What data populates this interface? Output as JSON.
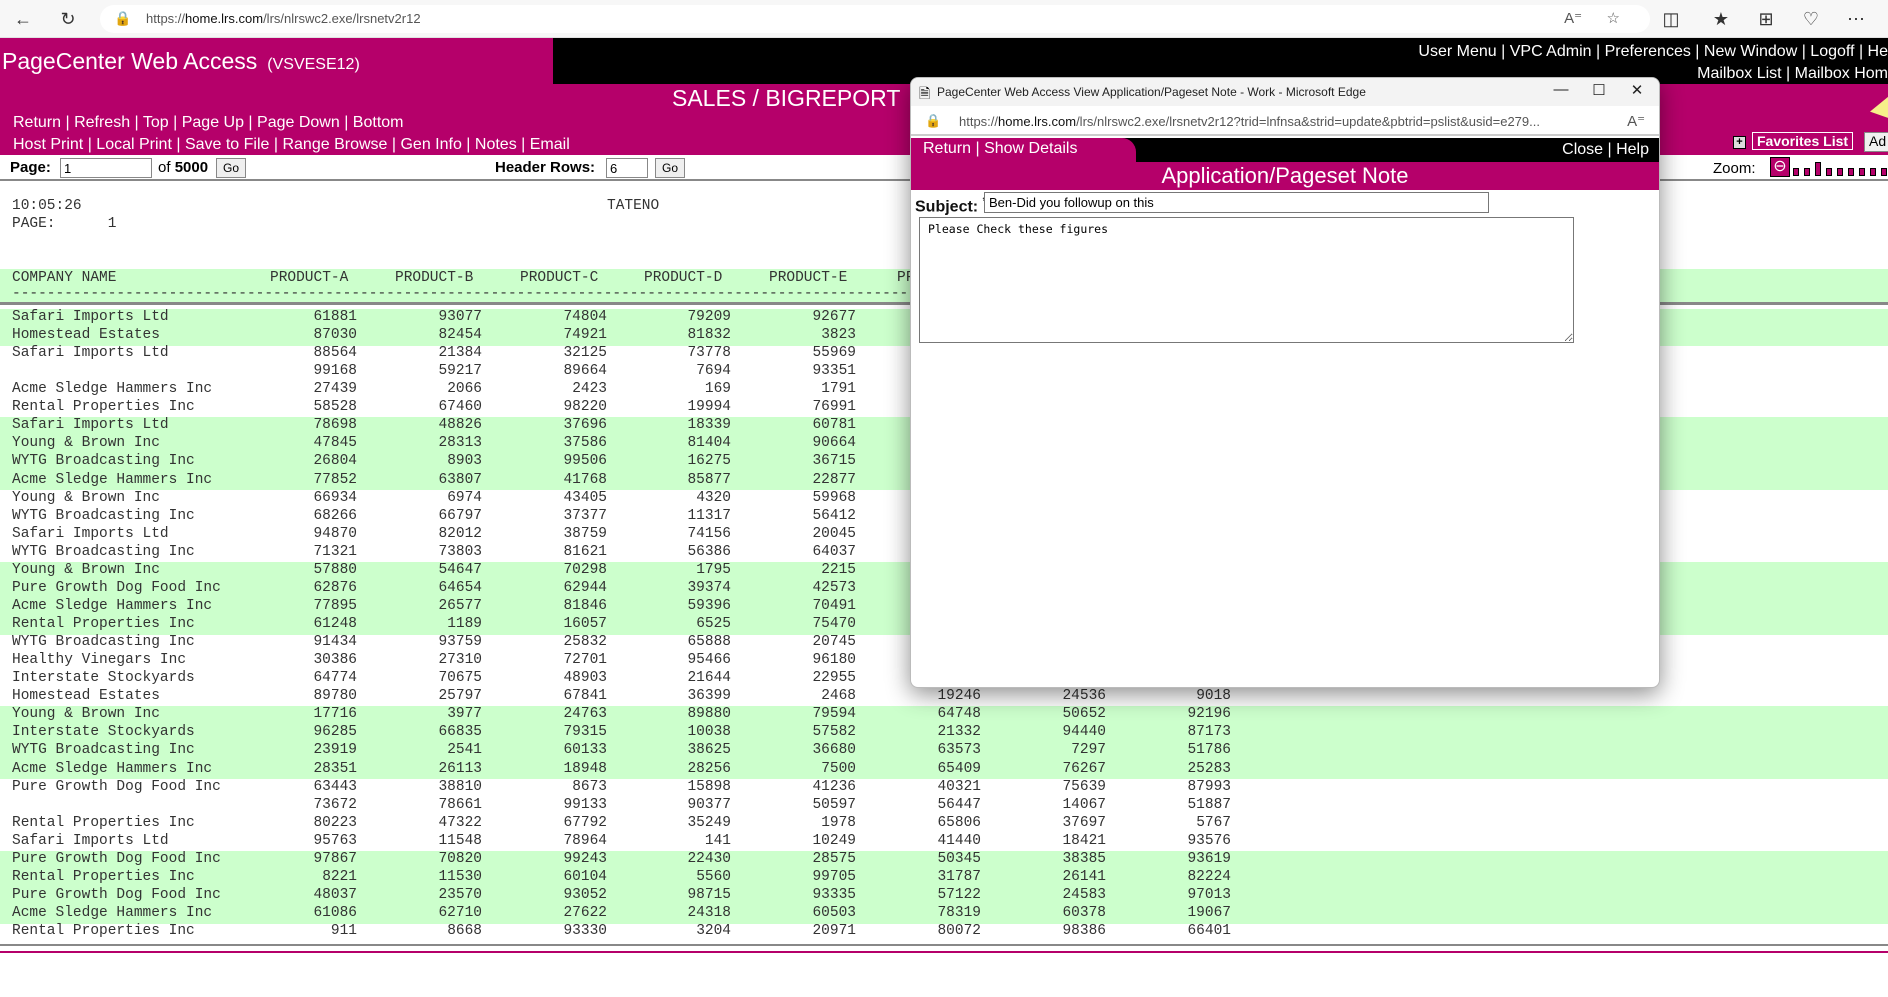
{
  "browser": {
    "url_prefix": "https://",
    "url_host": "home.lrs.com",
    "url_path": "/lrs/nlrswc2.exe/lrsnetv2r12",
    "icons": [
      "back-icon",
      "refresh-icon",
      "lock-icon",
      "read-aloud-icon",
      "favorite-star-icon",
      "split-screen-icon",
      "favorites-icon",
      "collections-icon",
      "browser-essentials-icon",
      "more-icon"
    ]
  },
  "header": {
    "app_title": "PageCenter Web Access",
    "app_subtitle": "(VSVESE12)",
    "top_links_row1": [
      "User Menu",
      "VPC Admin",
      "Preferences",
      "New Window",
      "Logoff",
      "He"
    ],
    "top_links_row2": [
      "Mailbox List",
      "Mailbox Hom"
    ],
    "report_title": "SALES / BIGREPORT",
    "nav_row1": [
      "Return",
      "Refresh",
      "Top",
      "Page Up",
      "Page Down",
      "Bottom"
    ],
    "nav_row2": [
      "Host Print",
      "Local Print",
      "Save to File",
      "Range Browse",
      "Gen Info",
      "Notes",
      "Email"
    ],
    "favorites_label": "Favorites List",
    "add_button_label": "Ad"
  },
  "toolbar": {
    "page_label": "Page:",
    "page_value": "1",
    "of_label": "of",
    "total_pages": "5000",
    "go_label": "Go",
    "header_rows_label": "Header Rows:",
    "header_rows_value": "6",
    "zoom_label": "Zoom:"
  },
  "report": {
    "time": "10:05:26",
    "page_label": "PAGE:",
    "page_number": "1",
    "center_label": "TATENO",
    "columns": [
      "COMPANY NAME",
      "PRODUCT-A",
      "PRODUCT-B",
      "PRODUCT-C",
      "PRODUCT-D",
      "PRODUCT-E",
      "PF"
    ],
    "dash_line": "----------------------------------------------------------------------------------------------------------------------------------------------------------",
    "rows": [
      {
        "name": "Safari Imports Ltd",
        "v": [
          "61881",
          "93077",
          "74804",
          "79209",
          "92677"
        ],
        "band": true
      },
      {
        "name": "Homestead Estates",
        "v": [
          "87030",
          "82454",
          "74921",
          "81832",
          "3823"
        ],
        "band": true
      },
      {
        "name": "Safari Imports Ltd",
        "v": [
          "88564",
          "21384",
          "32125",
          "73778",
          "55969"
        ],
        "band": false
      },
      {
        "name": "",
        "v": [
          "99168",
          "59217",
          "89664",
          "7694",
          "93351"
        ],
        "band": false
      },
      {
        "name": "Acme Sledge Hammers Inc",
        "v": [
          "27439",
          "2066",
          "2423",
          "169",
          "1791"
        ],
        "band": false
      },
      {
        "name": "Rental Properties Inc",
        "v": [
          "58528",
          "67460",
          "98220",
          "19994",
          "76991"
        ],
        "band": false
      },
      {
        "name": "Safari Imports Ltd",
        "v": [
          "78698",
          "48826",
          "37696",
          "18339",
          "60781"
        ],
        "band": true
      },
      {
        "name": "Young & Brown Inc",
        "v": [
          "47845",
          "28313",
          "37586",
          "81404",
          "90664"
        ],
        "band": true
      },
      {
        "name": "WYTG Broadcasting Inc",
        "v": [
          "26804",
          "8903",
          "99506",
          "16275",
          "36715"
        ],
        "band": true
      },
      {
        "name": "Acme Sledge Hammers Inc",
        "v": [
          "77852",
          "63807",
          "41768",
          "85877",
          "22877"
        ],
        "band": true
      },
      {
        "name": "Young & Brown Inc",
        "v": [
          "66934",
          "6974",
          "43405",
          "4320",
          "59968"
        ],
        "band": false
      },
      {
        "name": "WYTG Broadcasting Inc",
        "v": [
          "68266",
          "66797",
          "37377",
          "11317",
          "56412"
        ],
        "band": false
      },
      {
        "name": "Safari Imports Ltd",
        "v": [
          "94870",
          "82012",
          "38759",
          "74156",
          "20045"
        ],
        "band": false
      },
      {
        "name": "WYTG Broadcasting Inc",
        "v": [
          "71321",
          "73803",
          "81621",
          "56386",
          "64037"
        ],
        "band": false
      },
      {
        "name": "Young & Brown Inc",
        "v": [
          "57880",
          "54647",
          "70298",
          "1795",
          "2215"
        ],
        "band": true
      },
      {
        "name": "Pure Growth Dog Food Inc",
        "v": [
          "62876",
          "64654",
          "62944",
          "39374",
          "42573"
        ],
        "band": true
      },
      {
        "name": "Acme Sledge Hammers Inc",
        "v": [
          "77895",
          "26577",
          "81846",
          "59396",
          "70491"
        ],
        "band": true
      },
      {
        "name": "Rental Properties Inc",
        "v": [
          "61248",
          "1189",
          "16057",
          "6525",
          "75470"
        ],
        "band": true
      },
      {
        "name": "WYTG Broadcasting Inc",
        "v": [
          "91434",
          "93759",
          "25832",
          "65888",
          "20745"
        ],
        "band": false
      },
      {
        "name": "Healthy Vinegars Inc",
        "v": [
          "30386",
          "27310",
          "72701",
          "95466",
          "96180"
        ],
        "band": false
      },
      {
        "name": "Interstate Stockyards",
        "v": [
          "64774",
          "70675",
          "48903",
          "21644",
          "22955"
        ],
        "band": false
      },
      {
        "name": "Homestead Estates",
        "v": [
          "89780",
          "25797",
          "67841",
          "36399",
          "2468",
          "19246",
          "24536",
          "9018"
        ],
        "band": false
      },
      {
        "name": "Young & Brown Inc",
        "v": [
          "17716",
          "3977",
          "24763",
          "89880",
          "79594",
          "64748",
          "50652",
          "92196"
        ],
        "band": true
      },
      {
        "name": "Interstate Stockyards",
        "v": [
          "96285",
          "66835",
          "79315",
          "10038",
          "57582",
          "21332",
          "94440",
          "87173"
        ],
        "band": true
      },
      {
        "name": "WYTG Broadcasting Inc",
        "v": [
          "23919",
          "2541",
          "60133",
          "38625",
          "36680",
          "63573",
          "7297",
          "51786"
        ],
        "band": true
      },
      {
        "name": "Acme Sledge Hammers Inc",
        "v": [
          "28351",
          "26113",
          "18948",
          "28256",
          "7500",
          "65409",
          "76267",
          "25283"
        ],
        "band": true
      },
      {
        "name": "Pure Growth Dog Food Inc",
        "v": [
          "63443",
          "38810",
          "8673",
          "15898",
          "41236",
          "40321",
          "75639",
          "87993"
        ],
        "band": false
      },
      {
        "name": "",
        "v": [
          "73672",
          "78661",
          "99133",
          "90377",
          "50597",
          "56447",
          "14067",
          "51887"
        ],
        "band": false
      },
      {
        "name": "Rental Properties Inc",
        "v": [
          "80223",
          "47322",
          "67792",
          "35249",
          "1978",
          "65806",
          "37697",
          "5767"
        ],
        "band": false
      },
      {
        "name": "Safari Imports Ltd",
        "v": [
          "95763",
          "11548",
          "78964",
          "141",
          "10249",
          "41440",
          "18421",
          "93576"
        ],
        "band": false
      },
      {
        "name": "Pure Growth Dog Food Inc",
        "v": [
          "97867",
          "70820",
          "99243",
          "22430",
          "28575",
          "50345",
          "38385",
          "93619"
        ],
        "band": true
      },
      {
        "name": "Rental Properties Inc",
        "v": [
          "8221",
          "11530",
          "60104",
          "5560",
          "99705",
          "31787",
          "26141",
          "82224"
        ],
        "band": true
      },
      {
        "name": "Pure Growth Dog Food Inc",
        "v": [
          "48037",
          "23570",
          "93052",
          "98715",
          "93335",
          "57122",
          "24583",
          "97013"
        ],
        "band": true
      },
      {
        "name": "Acme Sledge Hammers Inc",
        "v": [
          "61086",
          "62710",
          "27622",
          "24318",
          "60503",
          "78319",
          "60378",
          "19067"
        ],
        "band": true
      },
      {
        "name": "Rental Properties Inc",
        "v": [
          "911",
          "8668",
          "93330",
          "3204",
          "20971",
          "80072",
          "98386",
          "66401"
        ],
        "band": false
      }
    ]
  },
  "popup": {
    "window_title": "PageCenter Web Access View Application/Pageset Note - Work - Microsoft Edge",
    "url_prefix": "https://",
    "url_host": "home.lrs.com",
    "url_rest": "/lrs/nlrswc2.exe/lrsnetv2r12?trid=lnfnsa&strid=update&pbtrid=pslist&usid=e279...",
    "left_links": [
      "Return",
      "Show Details"
    ],
    "right_links": [
      "Close",
      "Help"
    ],
    "heading": "Application/Pageset Note",
    "subject_label": "Subject:",
    "required_mark": "*",
    "subject_value": "Ben-Did you followup on this",
    "body_value": "Please Check these figures"
  }
}
